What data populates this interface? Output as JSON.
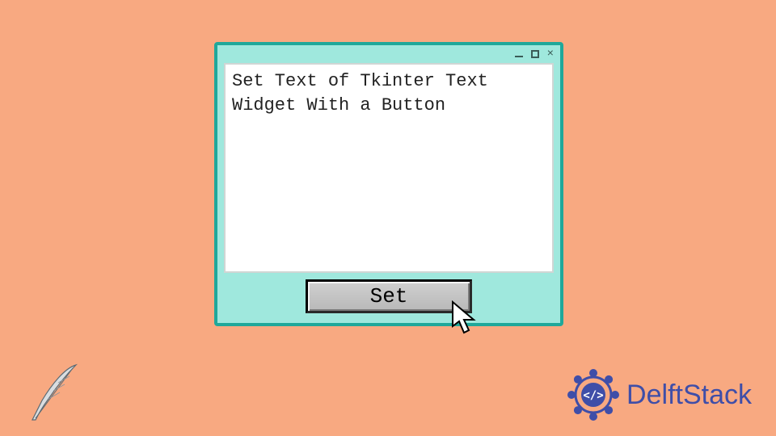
{
  "window": {
    "title": "",
    "controls": {
      "min": "minimize",
      "max": "maximize",
      "close": "×"
    }
  },
  "textarea": {
    "content": "Set Text of Tkinter Text Widget With a Button"
  },
  "button": {
    "label": "Set"
  },
  "brand": {
    "name": "DelftStack"
  },
  "colors": {
    "bg": "#f8a981",
    "accent": "#1fa89a",
    "brand": "#3f4ea8"
  }
}
